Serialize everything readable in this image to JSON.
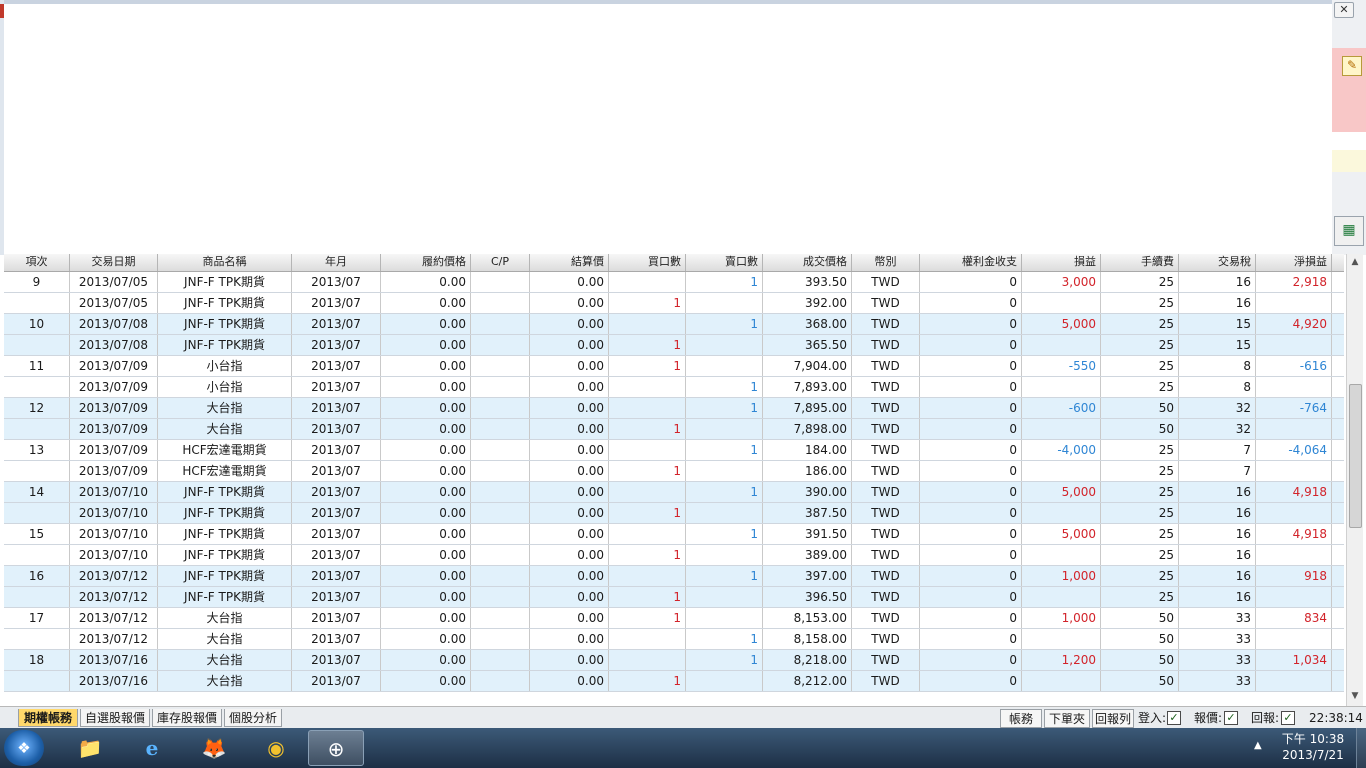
{
  "window": {
    "close_glyph": "✕"
  },
  "right_panel": {
    "pencil_icon": "pencil-icon",
    "excel_icon": "excel-export-icon"
  },
  "table": {
    "columns": [
      "項次",
      "交易日期",
      "商品名稱",
      "年月",
      "履約價格",
      "C/P",
      "結算價",
      "買口數",
      "賣口數",
      "成交價格",
      "幣別",
      "權利金收支",
      "損益",
      "手續費",
      "交易稅",
      "淨損益"
    ],
    "rows": [
      {
        "item": "9",
        "date": "2013/07/05",
        "product": "JNF-F TPK期貨",
        "ym": "2013/07",
        "strike": "0.00",
        "cp": "",
        "settle": "0.00",
        "buy": "",
        "sell": "1",
        "price": "393.50",
        "ccy": "TWD",
        "premium": "0",
        "pl": "3,000",
        "fee": "25",
        "tax": "16",
        "net": "2,918",
        "pl_color": "red",
        "net_color": "red"
      },
      {
        "item": "",
        "date": "2013/07/05",
        "product": "JNF-F TPK期貨",
        "ym": "2013/07",
        "strike": "0.00",
        "cp": "",
        "settle": "0.00",
        "buy": "1",
        "sell": "",
        "price": "392.00",
        "ccy": "TWD",
        "premium": "0",
        "pl": "",
        "fee": "25",
        "tax": "16",
        "net": "",
        "pl_color": "",
        "net_color": ""
      },
      {
        "item": "10",
        "date": "2013/07/08",
        "product": "JNF-F TPK期貨",
        "ym": "2013/07",
        "strike": "0.00",
        "cp": "",
        "settle": "0.00",
        "buy": "",
        "sell": "1",
        "price": "368.00",
        "ccy": "TWD",
        "premium": "0",
        "pl": "5,000",
        "fee": "25",
        "tax": "15",
        "net": "4,920",
        "pl_color": "red",
        "net_color": "red"
      },
      {
        "item": "",
        "date": "2013/07/08",
        "product": "JNF-F TPK期貨",
        "ym": "2013/07",
        "strike": "0.00",
        "cp": "",
        "settle": "0.00",
        "buy": "1",
        "sell": "",
        "price": "365.50",
        "ccy": "TWD",
        "premium": "0",
        "pl": "",
        "fee": "25",
        "tax": "15",
        "net": "",
        "pl_color": "",
        "net_color": ""
      },
      {
        "item": "11",
        "date": "2013/07/09",
        "product": "小台指",
        "ym": "2013/07",
        "strike": "0.00",
        "cp": "",
        "settle": "0.00",
        "buy": "1",
        "sell": "",
        "price": "7,904.00",
        "ccy": "TWD",
        "premium": "0",
        "pl": "-550",
        "fee": "25",
        "tax": "8",
        "net": "-616",
        "pl_color": "blue",
        "net_color": "blue"
      },
      {
        "item": "",
        "date": "2013/07/09",
        "product": "小台指",
        "ym": "2013/07",
        "strike": "0.00",
        "cp": "",
        "settle": "0.00",
        "buy": "",
        "sell": "1",
        "price": "7,893.00",
        "ccy": "TWD",
        "premium": "0",
        "pl": "",
        "fee": "25",
        "tax": "8",
        "net": "",
        "pl_color": "",
        "net_color": ""
      },
      {
        "item": "12",
        "date": "2013/07/09",
        "product": "大台指",
        "ym": "2013/07",
        "strike": "0.00",
        "cp": "",
        "settle": "0.00",
        "buy": "",
        "sell": "1",
        "price": "7,895.00",
        "ccy": "TWD",
        "premium": "0",
        "pl": "-600",
        "fee": "50",
        "tax": "32",
        "net": "-764",
        "pl_color": "blue",
        "net_color": "blue"
      },
      {
        "item": "",
        "date": "2013/07/09",
        "product": "大台指",
        "ym": "2013/07",
        "strike": "0.00",
        "cp": "",
        "settle": "0.00",
        "buy": "1",
        "sell": "",
        "price": "7,898.00",
        "ccy": "TWD",
        "premium": "0",
        "pl": "",
        "fee": "50",
        "tax": "32",
        "net": "",
        "pl_color": "",
        "net_color": ""
      },
      {
        "item": "13",
        "date": "2013/07/09",
        "product": "HCF宏達電期貨",
        "ym": "2013/07",
        "strike": "0.00",
        "cp": "",
        "settle": "0.00",
        "buy": "",
        "sell": "1",
        "price": "184.00",
        "ccy": "TWD",
        "premium": "0",
        "pl": "-4,000",
        "fee": "25",
        "tax": "7",
        "net": "-4,064",
        "pl_color": "blue",
        "net_color": "blue"
      },
      {
        "item": "",
        "date": "2013/07/09",
        "product": "HCF宏達電期貨",
        "ym": "2013/07",
        "strike": "0.00",
        "cp": "",
        "settle": "0.00",
        "buy": "1",
        "sell": "",
        "price": "186.00",
        "ccy": "TWD",
        "premium": "0",
        "pl": "",
        "fee": "25",
        "tax": "7",
        "net": "",
        "pl_color": "",
        "net_color": ""
      },
      {
        "item": "14",
        "date": "2013/07/10",
        "product": "JNF-F TPK期貨",
        "ym": "2013/07",
        "strike": "0.00",
        "cp": "",
        "settle": "0.00",
        "buy": "",
        "sell": "1",
        "price": "390.00",
        "ccy": "TWD",
        "premium": "0",
        "pl": "5,000",
        "fee": "25",
        "tax": "16",
        "net": "4,918",
        "pl_color": "red",
        "net_color": "red"
      },
      {
        "item": "",
        "date": "2013/07/10",
        "product": "JNF-F TPK期貨",
        "ym": "2013/07",
        "strike": "0.00",
        "cp": "",
        "settle": "0.00",
        "buy": "1",
        "sell": "",
        "price": "387.50",
        "ccy": "TWD",
        "premium": "0",
        "pl": "",
        "fee": "25",
        "tax": "16",
        "net": "",
        "pl_color": "",
        "net_color": ""
      },
      {
        "item": "15",
        "date": "2013/07/10",
        "product": "JNF-F TPK期貨",
        "ym": "2013/07",
        "strike": "0.00",
        "cp": "",
        "settle": "0.00",
        "buy": "",
        "sell": "1",
        "price": "391.50",
        "ccy": "TWD",
        "premium": "0",
        "pl": "5,000",
        "fee": "25",
        "tax": "16",
        "net": "4,918",
        "pl_color": "red",
        "net_color": "red"
      },
      {
        "item": "",
        "date": "2013/07/10",
        "product": "JNF-F TPK期貨",
        "ym": "2013/07",
        "strike": "0.00",
        "cp": "",
        "settle": "0.00",
        "buy": "1",
        "sell": "",
        "price": "389.00",
        "ccy": "TWD",
        "premium": "0",
        "pl": "",
        "fee": "25",
        "tax": "16",
        "net": "",
        "pl_color": "",
        "net_color": ""
      },
      {
        "item": "16",
        "date": "2013/07/12",
        "product": "JNF-F TPK期貨",
        "ym": "2013/07",
        "strike": "0.00",
        "cp": "",
        "settle": "0.00",
        "buy": "",
        "sell": "1",
        "price": "397.00",
        "ccy": "TWD",
        "premium": "0",
        "pl": "1,000",
        "fee": "25",
        "tax": "16",
        "net": "918",
        "pl_color": "red",
        "net_color": "red"
      },
      {
        "item": "",
        "date": "2013/07/12",
        "product": "JNF-F TPK期貨",
        "ym": "2013/07",
        "strike": "0.00",
        "cp": "",
        "settle": "0.00",
        "buy": "1",
        "sell": "",
        "price": "396.50",
        "ccy": "TWD",
        "premium": "0",
        "pl": "",
        "fee": "25",
        "tax": "16",
        "net": "",
        "pl_color": "",
        "net_color": ""
      },
      {
        "item": "17",
        "date": "2013/07/12",
        "product": "大台指",
        "ym": "2013/07",
        "strike": "0.00",
        "cp": "",
        "settle": "0.00",
        "buy": "1",
        "sell": "",
        "price": "8,153.00",
        "ccy": "TWD",
        "premium": "0",
        "pl": "1,000",
        "fee": "50",
        "tax": "33",
        "net": "834",
        "pl_color": "red",
        "net_color": "red"
      },
      {
        "item": "",
        "date": "2013/07/12",
        "product": "大台指",
        "ym": "2013/07",
        "strike": "0.00",
        "cp": "",
        "settle": "0.00",
        "buy": "",
        "sell": "1",
        "price": "8,158.00",
        "ccy": "TWD",
        "premium": "0",
        "pl": "",
        "fee": "50",
        "tax": "33",
        "net": "",
        "pl_color": "",
        "net_color": ""
      },
      {
        "item": "18",
        "date": "2013/07/16",
        "product": "大台指",
        "ym": "2013/07",
        "strike": "0.00",
        "cp": "",
        "settle": "0.00",
        "buy": "",
        "sell": "1",
        "price": "8,218.00",
        "ccy": "TWD",
        "premium": "0",
        "pl": "1,200",
        "fee": "50",
        "tax": "33",
        "net": "1,034",
        "pl_color": "red",
        "net_color": "red"
      },
      {
        "item": "",
        "date": "2013/07/16",
        "product": "大台指",
        "ym": "2013/07",
        "strike": "0.00",
        "cp": "",
        "settle": "0.00",
        "buy": "1",
        "sell": "",
        "price": "8,212.00",
        "ccy": "TWD",
        "premium": "0",
        "pl": "",
        "fee": "50",
        "tax": "33",
        "net": "",
        "pl_color": "",
        "net_color": ""
      }
    ]
  },
  "bottom_bar": {
    "tabs": [
      "期權帳務",
      "自選股報價",
      "庫存股報價",
      "個股分析"
    ],
    "buttons": [
      "帳務",
      "下單夾",
      "回報列"
    ],
    "login_label": "登入:",
    "quote_label": "報價:",
    "report_label": "回報:",
    "check_glyph": "✓",
    "time": "22:38:14"
  },
  "taskbar": {
    "start_glyph": "❖",
    "apps": [
      {
        "name": "file-explorer-icon",
        "glyph": "📁"
      },
      {
        "name": "internet-explorer-icon",
        "glyph": "e"
      },
      {
        "name": "firefox-icon",
        "glyph": "🦊"
      },
      {
        "name": "chrome-icon",
        "glyph": "◉"
      },
      {
        "name": "trading-app-icon",
        "glyph": "⊕"
      }
    ],
    "tray_arrow": "▲",
    "tray_time": "下午 10:38",
    "tray_date": "2013/7/21"
  }
}
